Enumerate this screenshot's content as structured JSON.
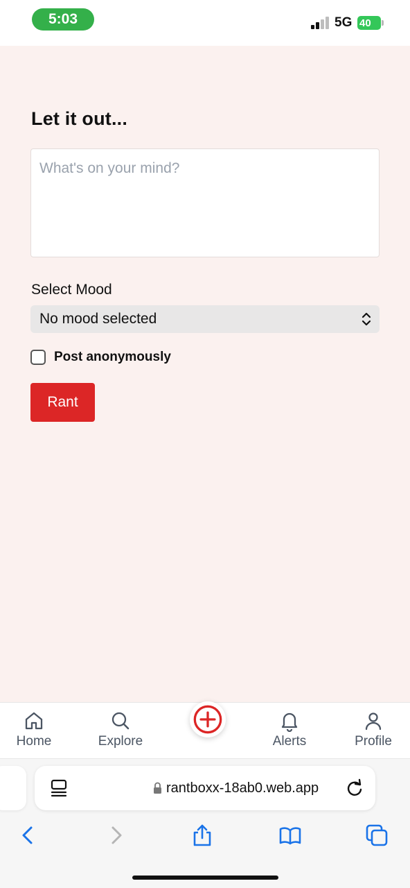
{
  "status_bar": {
    "time": "5:03",
    "network": "5G",
    "battery": "40"
  },
  "composer": {
    "title": "Let it out...",
    "textarea_placeholder": "What's on your mind?",
    "mood_label": "Select Mood",
    "mood_selected": "No mood selected",
    "anonymous_label": "Post anonymously",
    "anonymous_checked": false,
    "submit_label": "Rant"
  },
  "bottom_nav": {
    "items": [
      {
        "label": "Home",
        "icon": "home-icon"
      },
      {
        "label": "Explore",
        "icon": "search-icon"
      },
      {
        "label": "",
        "icon": "add-circle-icon"
      },
      {
        "label": "Alerts",
        "icon": "bell-icon"
      },
      {
        "label": "Profile",
        "icon": "user-icon"
      }
    ]
  },
  "browser": {
    "url": "rantboxx-18ab0.web.app",
    "toolbar_icons": [
      "back-icon",
      "forward-icon",
      "share-icon",
      "bookmarks-icon",
      "tabs-icon"
    ]
  },
  "colors": {
    "accent": "#dc2626",
    "page_background": "#fbf1ef",
    "time_pill": "#34b04a",
    "link_blue": "#1a73e8"
  }
}
